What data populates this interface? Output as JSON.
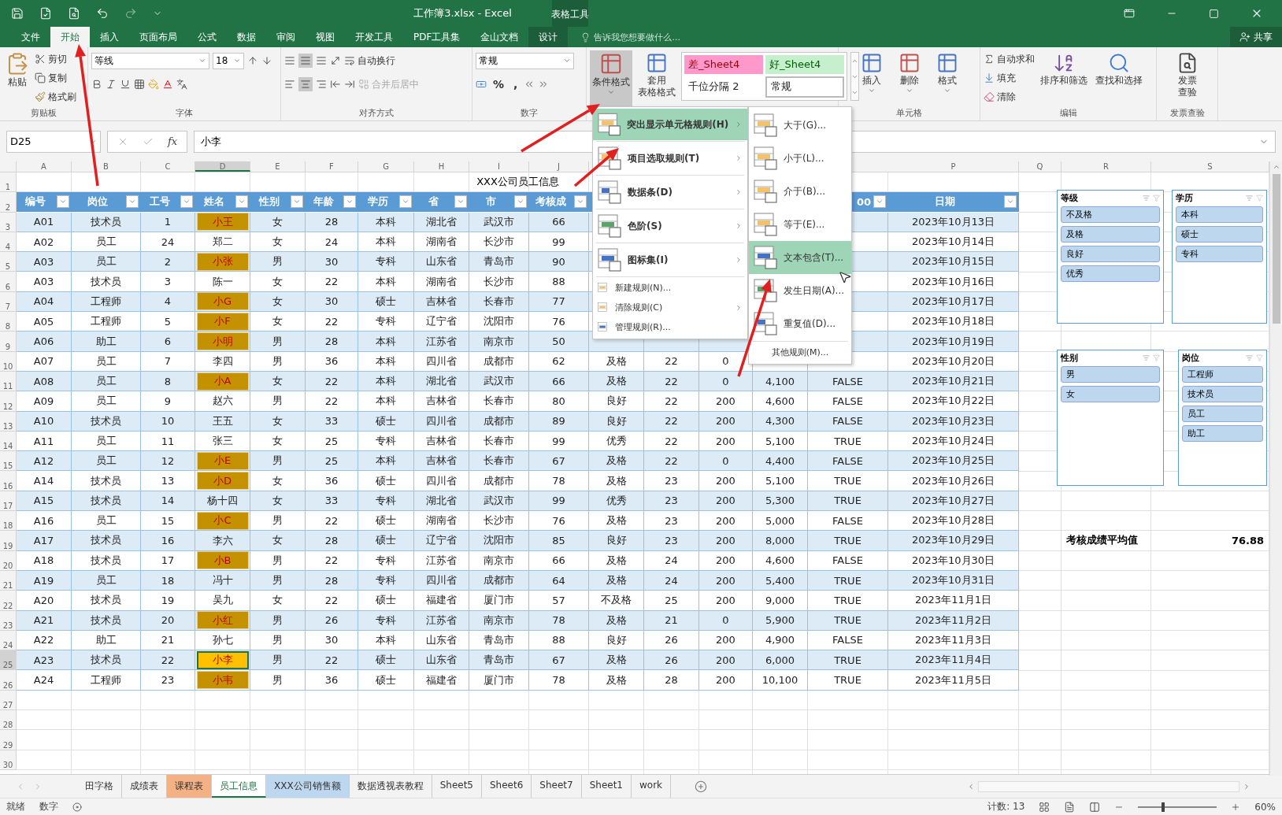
{
  "title_bar": {
    "title": "工作簿3.xlsx - Excel",
    "context": "表格工具"
  },
  "tabs": [
    {
      "label": "文件",
      "selected": false,
      "kind": "normal"
    },
    {
      "label": "开始",
      "selected": true,
      "kind": "normal"
    },
    {
      "label": "插入",
      "selected": false,
      "kind": "normal"
    },
    {
      "label": "页面布局",
      "selected": false,
      "kind": "normal"
    },
    {
      "label": "公式",
      "selected": false,
      "kind": "normal"
    },
    {
      "label": "数据",
      "selected": false,
      "kind": "normal"
    },
    {
      "label": "审阅",
      "selected": false,
      "kind": "normal"
    },
    {
      "label": "视图",
      "selected": false,
      "kind": "normal"
    },
    {
      "label": "开发工具",
      "selected": false,
      "kind": "normal"
    },
    {
      "label": "PDF工具集",
      "selected": false,
      "kind": "normal"
    },
    {
      "label": "金山文档",
      "selected": false,
      "kind": "normal"
    },
    {
      "label": "设计",
      "selected": false,
      "kind": "context"
    }
  ],
  "tell_me": {
    "placeholder": "告诉我您想要做什么..."
  },
  "share": "共享",
  "ribbon": {
    "clipboard": {
      "label": "剪贴板",
      "paste": "粘贴",
      "cut": "剪切",
      "copy": "复制",
      "painter": "格式刷"
    },
    "font": {
      "label": "字体",
      "name": "等线",
      "size": "18"
    },
    "align": {
      "label": "对齐方式",
      "wrap": "自动换行",
      "merge": "合并后居中",
      "merge_disabled": true
    },
    "number": {
      "label": "数字",
      "format": "常规",
      "percent": "%",
      "comma": ","
    },
    "styles": {
      "conditional": "条件格式",
      "pressed": true,
      "table_format": [
        "套用",
        "表格格式"
      ],
      "gallery": [
        {
          "label": "差_Sheet4",
          "kind": "bad"
        },
        {
          "label": "好_Sheet4",
          "kind": "good"
        },
        {
          "label": "千位分隔 2",
          "kind": "plain"
        },
        {
          "label": "常规",
          "kind": "normal"
        }
      ]
    },
    "cells": {
      "label": "单元格",
      "buttons": [
        "插入",
        "删除",
        "格式"
      ]
    },
    "editing": {
      "label": "编辑",
      "autosum": "自动求和",
      "fill": "填充",
      "clear": "清除",
      "sort": "排序和筛选",
      "find": "查找和选择"
    },
    "invoice": {
      "label": "发票查验",
      "button": [
        "发票",
        "查验"
      ]
    }
  },
  "formula_bar": {
    "name_box": "D25",
    "fx": "fx",
    "value": "小李"
  },
  "columns_left": [
    {
      "label": "A",
      "selected": false
    },
    {
      "label": "B",
      "selected": false
    },
    {
      "label": "C",
      "selected": false
    },
    {
      "label": "D",
      "selected": true
    },
    {
      "label": "E",
      "selected": false
    },
    {
      "label": "F",
      "selected": false
    },
    {
      "label": "G",
      "selected": false
    },
    {
      "label": "H",
      "selected": false
    },
    {
      "label": "I",
      "selected": false
    },
    {
      "label": "J",
      "selected": false
    }
  ],
  "columns_right": [
    {
      "label": "P",
      "selected": false
    },
    {
      "label": "Q",
      "selected": false
    },
    {
      "label": "R",
      "selected": false
    },
    {
      "label": "S",
      "selected": false
    }
  ],
  "row_numbers": [
    {
      "label": "1",
      "selected": false
    },
    {
      "label": "2",
      "selected": false
    },
    {
      "label": "3",
      "selected": false
    },
    {
      "label": "4",
      "selected": false
    },
    {
      "label": "5",
      "selected": false
    },
    {
      "label": "6",
      "selected": false
    },
    {
      "label": "7",
      "selected": false
    },
    {
      "label": "8",
      "selected": false
    },
    {
      "label": "9",
      "selected": false
    },
    {
      "label": "10",
      "selected": false
    },
    {
      "label": "11",
      "selected": false
    },
    {
      "label": "12",
      "selected": false
    },
    {
      "label": "13",
      "selected": false
    },
    {
      "label": "14",
      "selected": false
    },
    {
      "label": "15",
      "selected": false
    },
    {
      "label": "16",
      "selected": false
    },
    {
      "label": "17",
      "selected": false
    },
    {
      "label": "18",
      "selected": false
    },
    {
      "label": "19",
      "selected": false
    },
    {
      "label": "20",
      "selected": false
    },
    {
      "label": "21",
      "selected": false
    },
    {
      "label": "22",
      "selected": false
    },
    {
      "label": "23",
      "selected": false
    },
    {
      "label": "24",
      "selected": false
    },
    {
      "label": "25",
      "selected": true
    },
    {
      "label": "26",
      "selected": false
    },
    {
      "label": "27",
      "selected": false
    },
    {
      "label": "28",
      "selected": false
    },
    {
      "label": "29",
      "selected": false
    },
    {
      "label": "30",
      "selected": false
    }
  ],
  "sheet_title": "XXX公司员工信息",
  "header_left": [
    "编号",
    "岗位",
    "工号",
    "姓名",
    "性别",
    "年龄",
    "学历",
    "省",
    "市",
    "考核成"
  ],
  "header_o": "00",
  "header_p": "日期",
  "rows": [
    {
      "cells": [
        "A01",
        "技术员",
        "1",
        "小王",
        "女",
        "28",
        "本科",
        "湖北省",
        "武汉市",
        "66",
        null,
        null,
        null,
        null,
        null,
        "2023年10月13日"
      ],
      "highlight": true,
      "active": false
    },
    {
      "cells": [
        "A02",
        "员工",
        "24",
        "郑二",
        "女",
        "24",
        "本科",
        "湖南省",
        "长沙市",
        "99",
        null,
        null,
        null,
        null,
        null,
        "2023年10月14日"
      ],
      "highlight": false,
      "active": false
    },
    {
      "cells": [
        "A03",
        "员工",
        "2",
        "小张",
        "男",
        "30",
        "专科",
        "山东省",
        "青岛市",
        "90",
        null,
        null,
        null,
        null,
        null,
        "2023年10月15日"
      ],
      "highlight": true,
      "active": false
    },
    {
      "cells": [
        "A03",
        "技术员",
        "3",
        "陈一",
        "女",
        "22",
        "本科",
        "湖南省",
        "长沙市",
        "88",
        null,
        null,
        null,
        null,
        null,
        "2023年10月16日"
      ],
      "highlight": false,
      "active": false
    },
    {
      "cells": [
        "A04",
        "工程师",
        "4",
        "小G",
        "女",
        "30",
        "硕士",
        "吉林省",
        "长春市",
        "77",
        null,
        null,
        null,
        null,
        null,
        "2023年10月17日"
      ],
      "highlight": true,
      "active": false
    },
    {
      "cells": [
        "A05",
        "工程师",
        "5",
        "小F",
        "女",
        "22",
        "专科",
        "辽宁省",
        "沈阳市",
        "76",
        null,
        null,
        null,
        null,
        null,
        "2023年10月18日"
      ],
      "highlight": true,
      "active": false
    },
    {
      "cells": [
        "A06",
        "助工",
        "6",
        "小明",
        "男",
        "28",
        "本科",
        "江苏省",
        "南京市",
        "50",
        null,
        null,
        null,
        null,
        null,
        "2023年10月19日"
      ],
      "highlight": true,
      "active": false
    },
    {
      "cells": [
        "A07",
        "员工",
        "7",
        "李四",
        "男",
        "36",
        "本科",
        "四川省",
        "成都市",
        "62",
        "及格",
        "22",
        "0",
        null,
        null,
        "2023年10月20日"
      ],
      "highlight": false,
      "active": false
    },
    {
      "cells": [
        "A08",
        "员工",
        "8",
        "小A",
        "女",
        "22",
        "本科",
        "湖北省",
        "武汉市",
        "66",
        "及格",
        "22",
        "0",
        "4,100",
        "FALSE",
        "2023年10月21日"
      ],
      "highlight": true,
      "active": false
    },
    {
      "cells": [
        "A09",
        "员工",
        "9",
        "赵六",
        "男",
        "22",
        "本科",
        "吉林省",
        "长春市",
        "80",
        "良好",
        "22",
        "200",
        "4,600",
        "FALSE",
        "2023年10月22日"
      ],
      "highlight": false,
      "active": false
    },
    {
      "cells": [
        "A10",
        "技术员",
        "10",
        "王五",
        "女",
        "33",
        "硕士",
        "四川省",
        "成都市",
        "89",
        "良好",
        "22",
        "200",
        "4,300",
        "FALSE",
        "2023年10月23日"
      ],
      "highlight": false,
      "active": false
    },
    {
      "cells": [
        "A11",
        "员工",
        "11",
        "张三",
        "女",
        "25",
        "专科",
        "吉林省",
        "长春市",
        "99",
        "优秀",
        "22",
        "200",
        "5,100",
        "TRUE",
        "2023年10月24日"
      ],
      "highlight": false,
      "active": false
    },
    {
      "cells": [
        "A12",
        "员工",
        "12",
        "小E",
        "男",
        "25",
        "本科",
        "吉林省",
        "长春市",
        "67",
        "及格",
        "22",
        "0",
        "4,400",
        "FALSE",
        "2023年10月25日"
      ],
      "highlight": true,
      "active": false
    },
    {
      "cells": [
        "A14",
        "技术员",
        "13",
        "小D",
        "女",
        "36",
        "硕士",
        "四川省",
        "成都市",
        "78",
        "及格",
        "23",
        "200",
        "5,100",
        "TRUE",
        "2023年10月26日"
      ],
      "highlight": true,
      "active": false
    },
    {
      "cells": [
        "A15",
        "技术员",
        "14",
        "杨十四",
        "女",
        "33",
        "专科",
        "湖北省",
        "武汉市",
        "99",
        "优秀",
        "23",
        "200",
        "5,300",
        "TRUE",
        "2023年10月27日"
      ],
      "highlight": false,
      "active": false
    },
    {
      "cells": [
        "A16",
        "员工",
        "15",
        "小C",
        "男",
        "22",
        "硕士",
        "湖南省",
        "长沙市",
        "76",
        "及格",
        "23",
        "200",
        "5,000",
        "FALSE",
        "2023年10月28日"
      ],
      "highlight": true,
      "active": false
    },
    {
      "cells": [
        "A17",
        "技术员",
        "16",
        "李六",
        "女",
        "28",
        "硕士",
        "辽宁省",
        "沈阳市",
        "85",
        "良好",
        "23",
        "200",
        "8,000",
        "TRUE",
        "2023年10月29日"
      ],
      "highlight": false,
      "active": false,
      "side": [
        "考核成绩平均值",
        "76.88"
      ]
    },
    {
      "cells": [
        "A18",
        "技术员",
        "17",
        "小B",
        "男",
        "22",
        "专科",
        "江苏省",
        "南京市",
        "66",
        "及格",
        "24",
        "200",
        "4,600",
        "FALSE",
        "2023年10月30日"
      ],
      "highlight": true,
      "active": false
    },
    {
      "cells": [
        "A19",
        "员工",
        "18",
        "冯十",
        "男",
        "28",
        "专科",
        "四川省",
        "成都市",
        "64",
        "及格",
        "24",
        "200",
        "5,400",
        "TRUE",
        "2023年10月31日"
      ],
      "highlight": false,
      "active": false
    },
    {
      "cells": [
        "A20",
        "技术员",
        "19",
        "吴九",
        "女",
        "22",
        "硕士",
        "福建省",
        "厦门市",
        "57",
        "不及格",
        "25",
        "200",
        "9,000",
        "TRUE",
        "2023年11月1日"
      ],
      "highlight": false,
      "active": false
    },
    {
      "cells": [
        "A21",
        "技术员",
        "20",
        "小红",
        "男",
        "26",
        "专科",
        "江苏省",
        "南京市",
        "78",
        "及格",
        "21",
        "0",
        "5,900",
        "TRUE",
        "2023年11月2日"
      ],
      "highlight": true,
      "active": false
    },
    {
      "cells": [
        "A22",
        "助工",
        "21",
        "孙七",
        "男",
        "30",
        "本科",
        "山东省",
        "青岛市",
        "88",
        "良好",
        "26",
        "200",
        "4,900",
        "FALSE",
        "2023年11月3日"
      ],
      "highlight": false,
      "active": false
    },
    {
      "cells": [
        "A23",
        "技术员",
        "22",
        "小李",
        "男",
        "22",
        "硕士",
        "山东省",
        "青岛市",
        "67",
        "及格",
        "26",
        "200",
        "6,000",
        "TRUE",
        "2023年11月4日"
      ],
      "highlight": true,
      "active": true
    },
    {
      "cells": [
        "A24",
        "工程师",
        "23",
        "小韦",
        "男",
        "36",
        "硕士",
        "福建省",
        "厦门市",
        "78",
        "及格",
        "28",
        "200",
        "10,100",
        "TRUE",
        "2023年11月5日"
      ],
      "highlight": true,
      "active": false
    }
  ],
  "slicers": [
    {
      "title": "等级",
      "items": [
        "不及格",
        "及格",
        "良好",
        "优秀"
      ]
    },
    {
      "title": "学历",
      "items": [
        "本科",
        "硕士",
        "专科"
      ]
    },
    {
      "title": "性别",
      "items": [
        "男",
        "女"
      ]
    },
    {
      "title": "岗位",
      "items": [
        "工程师",
        "技术员",
        "员工",
        "助工"
      ]
    }
  ],
  "menu": {
    "items": [
      {
        "label": "突出显示单元格规则(H)",
        "kind": "large",
        "selected": true,
        "submenu": true
      },
      {
        "label": "项目选取规则(T)",
        "kind": "large",
        "selected": false,
        "submenu": true
      },
      {
        "label": "数据条(D)",
        "kind": "large",
        "selected": false,
        "submenu": true
      },
      {
        "label": "色阶(S)",
        "kind": "large",
        "selected": false,
        "submenu": true
      },
      {
        "label": "图标集(I)",
        "kind": "large",
        "selected": false,
        "submenu": true
      },
      {
        "label": "新建规则(N)...",
        "kind": "small",
        "selected": false,
        "submenu": false
      },
      {
        "label": "清除规则(C)",
        "kind": "small",
        "selected": false,
        "submenu": true
      },
      {
        "label": "管理规则(R)...",
        "kind": "small",
        "selected": false,
        "submenu": false
      }
    ]
  },
  "submenu": {
    "items": [
      {
        "label": "大于(G)...",
        "selected": false
      },
      {
        "label": "小于(L)...",
        "selected": false
      },
      {
        "label": "介于(B)...",
        "selected": false
      },
      {
        "label": "等于(E)...",
        "selected": false
      },
      {
        "label": "文本包含(T)...",
        "selected": true
      },
      {
        "label": "发生日期(A)...",
        "selected": false
      },
      {
        "label": "重复值(D)...",
        "selected": false
      }
    ],
    "footer": "其他规则(M)..."
  },
  "sheet_tabs": [
    {
      "label": "田字格",
      "selected": false
    },
    {
      "label": "成绩表",
      "selected": false
    },
    {
      "label": "课程表",
      "selected": false,
      "color": "#f4b183"
    },
    {
      "label": "员工信息",
      "selected": true
    },
    {
      "label": "XXX公司销售额",
      "selected": false,
      "color": "#bdd7ee"
    },
    {
      "label": "数据透视表教程",
      "selected": false
    },
    {
      "label": "Sheet5",
      "selected": false
    },
    {
      "label": "Sheet6",
      "selected": false
    },
    {
      "label": "Sheet7",
      "selected": false
    },
    {
      "label": "Sheet1",
      "selected": false
    },
    {
      "label": "work",
      "selected": false
    }
  ],
  "status_bar": {
    "ready": "就绪",
    "mode": "数字",
    "count": "计数: 13",
    "zoom": {
      "level": 0.3,
      "reading": "60%"
    }
  }
}
